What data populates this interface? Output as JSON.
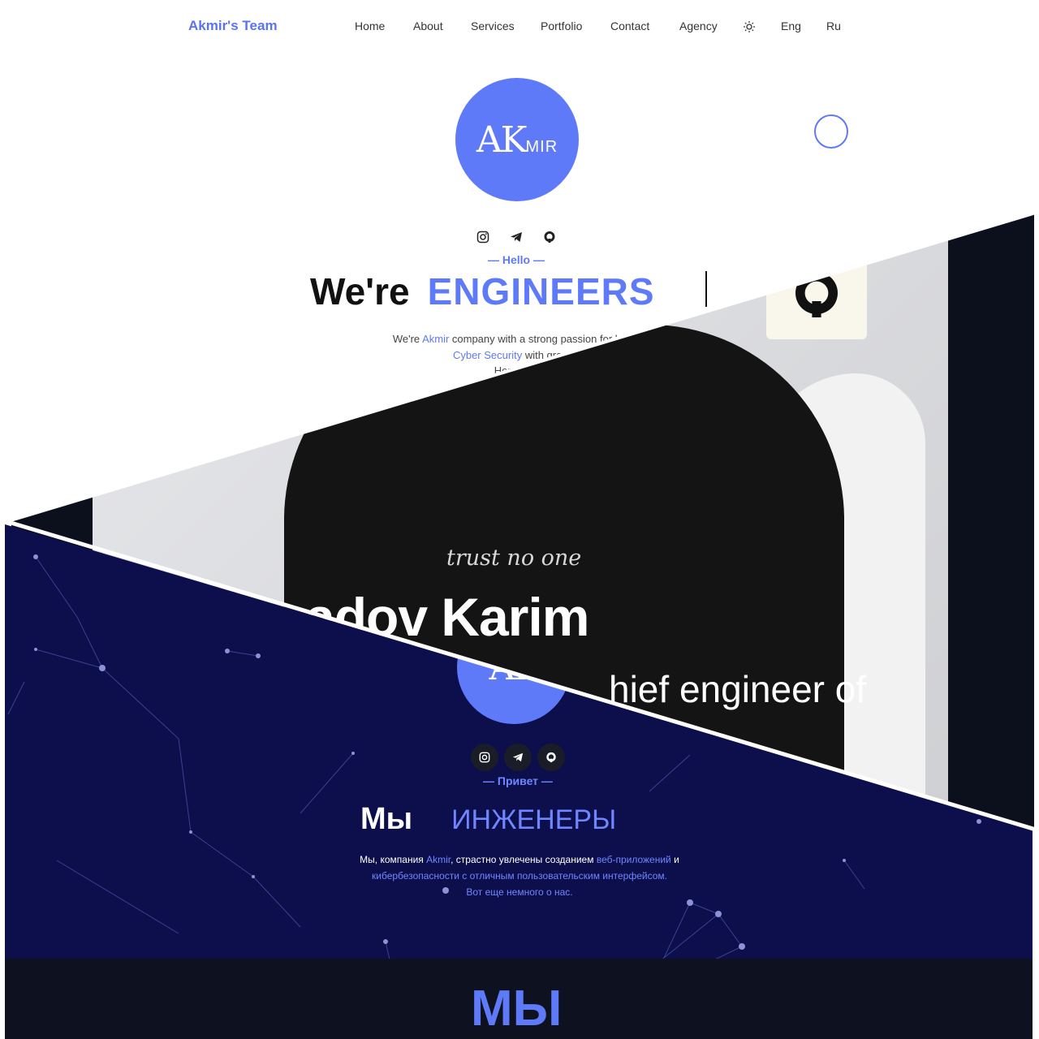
{
  "light": {
    "brand": "Akmir's Team",
    "nav": [
      {
        "label": "Home"
      },
      {
        "label": "About"
      },
      {
        "label": "Services"
      },
      {
        "label": "Portfolio"
      },
      {
        "label": "Contact"
      },
      {
        "label": "Agency"
      }
    ],
    "lang_en": "Eng",
    "lang_ru": "Ru",
    "logo_main": "AK",
    "logo_sub": "MIR",
    "greeting": "— Hello —",
    "headline_lead": "We're",
    "headline_accent": "ENGINEERS",
    "para_1a": "We're ",
    "para_1b": "Akmir",
    "para_1c": " company with a strong passion for buildi",
    "para_2a": "Cyber Security",
    "para_2b": " with great u",
    "para_3": "Here's a l"
  },
  "photo": {
    "shirt_print": "trust no one",
    "name_fragment": "adov Karim",
    "role_fragment": "hief engineer of"
  },
  "dark": {
    "logo_main": "AK",
    "greeting": "— Привет —",
    "headline_lead": "Мы",
    "headline_accent": "ИНЖЕНЕРЫ",
    "para_1a": "Мы, компания ",
    "para_1b": "Akmir",
    "para_1c": ", страстно увлечены созданием ",
    "para_1d": "веб-приложений",
    "para_1e": " и",
    "para_2": "кибербезопасности с отличным пользовательским интерфейсом.",
    "para_3": "Вот еще немного о нас.",
    "footer_title": "МЫ"
  },
  "colors": {
    "accent": "#5f7af8",
    "dark_bg": "#0d0f4d",
    "footer_bg": "#0e1220"
  },
  "icons": [
    "instagram-icon",
    "telegram-icon",
    "github-icon",
    "sun-icon"
  ]
}
